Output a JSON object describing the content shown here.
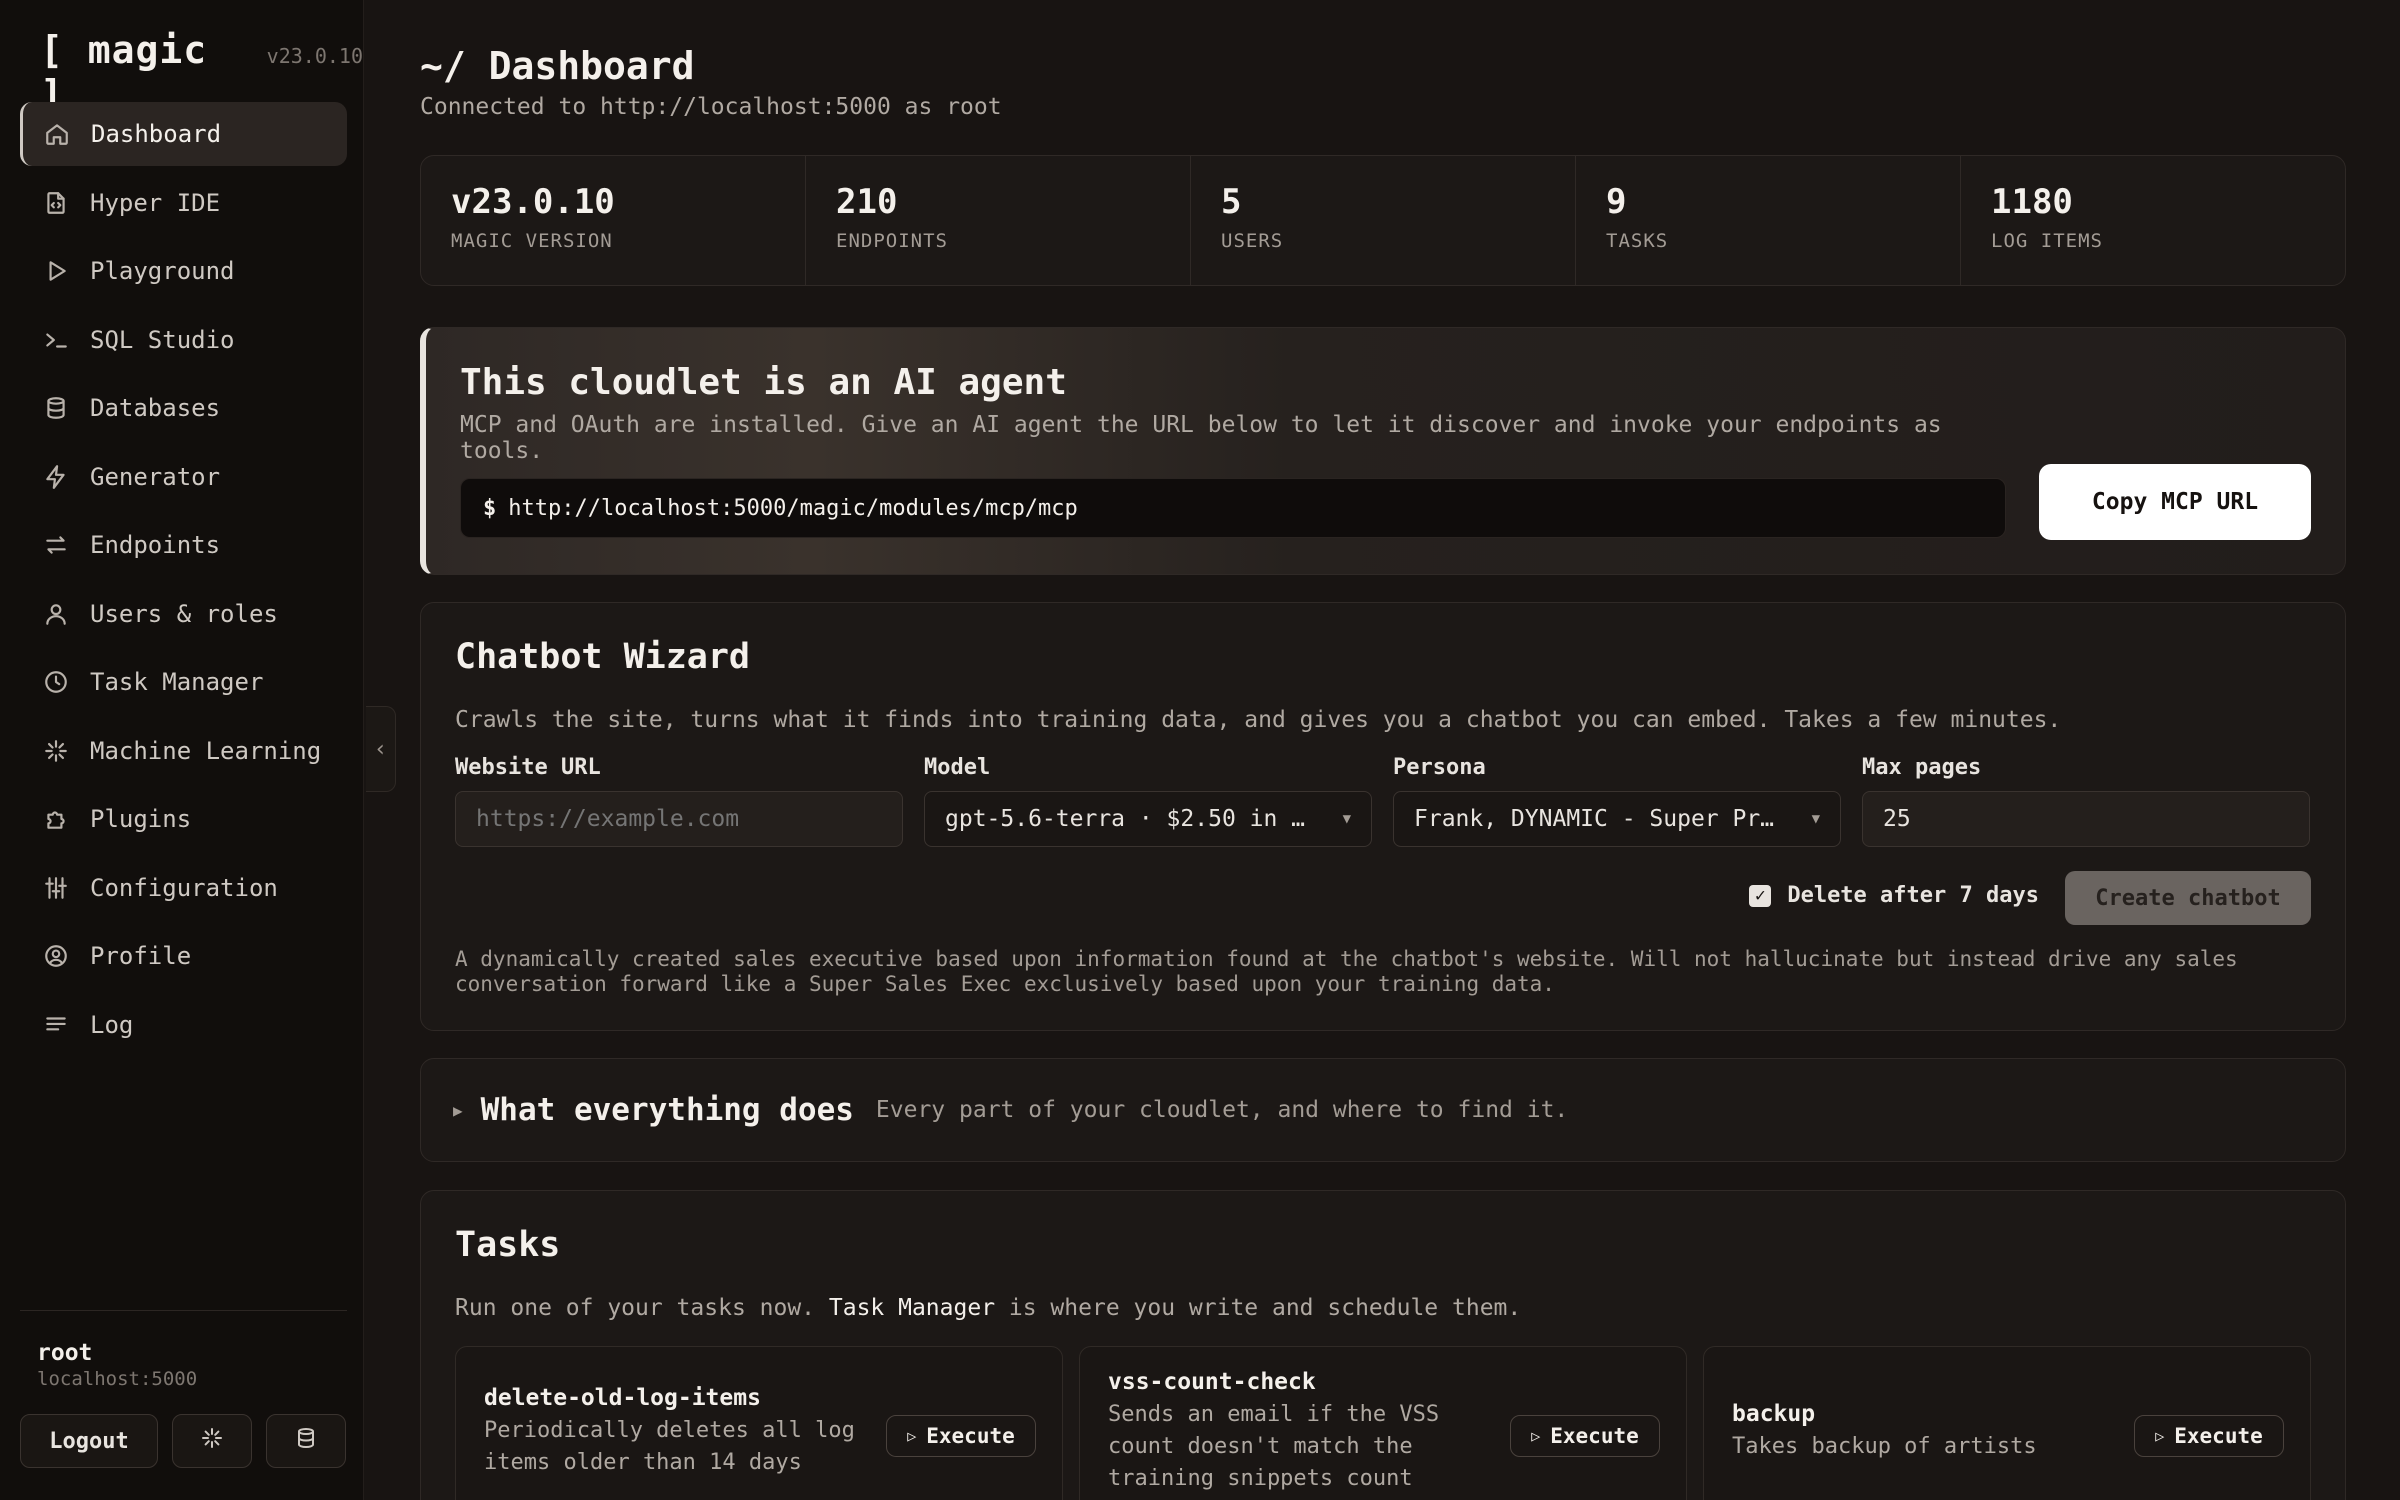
{
  "brand": {
    "name": "[ magic ]",
    "version": "v23.0.10"
  },
  "nav": [
    {
      "label": "Dashboard",
      "icon": "home-icon"
    },
    {
      "label": "Hyper IDE",
      "icon": "code-file-icon"
    },
    {
      "label": "Playground",
      "icon": "play-icon"
    },
    {
      "label": "SQL Studio",
      "icon": "terminal-icon"
    },
    {
      "label": "Databases",
      "icon": "database-icon"
    },
    {
      "label": "Generator",
      "icon": "lightning-icon"
    },
    {
      "label": "Endpoints",
      "icon": "arrows-icon"
    },
    {
      "label": "Users & roles",
      "icon": "user-icon"
    },
    {
      "label": "Task Manager",
      "icon": "clock-icon"
    },
    {
      "label": "Machine Learning",
      "icon": "sparkle-icon"
    },
    {
      "label": "Plugins",
      "icon": "puzzle-icon"
    },
    {
      "label": "Configuration",
      "icon": "sliders-icon"
    },
    {
      "label": "Profile",
      "icon": "profile-icon"
    },
    {
      "label": "Log",
      "icon": "list-icon"
    }
  ],
  "user": {
    "name": "root",
    "host": "localhost:5000",
    "logout_label": "Logout"
  },
  "header": {
    "title": "~/ Dashboard",
    "subtitle": "Connected to http://localhost:5000 as root"
  },
  "stats": [
    {
      "value": "v23.0.10",
      "label": "MAGIC VERSION"
    },
    {
      "value": "210",
      "label": "ENDPOINTS"
    },
    {
      "value": "5",
      "label": "USERS"
    },
    {
      "value": "9",
      "label": "TASKS"
    },
    {
      "value": "1180",
      "label": "LOG ITEMS"
    }
  ],
  "agent": {
    "title": "This cloudlet is an AI agent",
    "description": "MCP and OAuth are installed. Give an AI agent the URL below to let it discover and invoke your endpoints as tools.",
    "prompt": "$",
    "url": "http://localhost:5000/magic/modules/mcp/mcp",
    "copy_label": "Copy MCP URL"
  },
  "wizard": {
    "title": "Chatbot Wizard",
    "description": "Crawls the site, turns what it finds into training data, and gives you a chatbot you can embed. Takes a few minutes.",
    "website_label": "Website URL",
    "website_placeholder": "https://example.com",
    "model_label": "Model",
    "model_value": "gpt-5.6-terra · $2.50 in …",
    "persona_label": "Persona",
    "persona_value": "Frank, DYNAMIC - Super Pr…",
    "max_pages_label": "Max pages",
    "max_pages_value": "25",
    "delete_label": "Delete after 7 days",
    "delete_checked": true,
    "create_label": "Create chatbot",
    "persona_description": "A dynamically created sales executive based upon information found at the chatbot's website. Will not hallucinate but instead drive any sales conversation forward like a Super Sales Exec exclusively based upon your training data."
  },
  "everything": {
    "title": "What everything does",
    "subtitle": "Every part of your cloudlet, and where to find it."
  },
  "tasks": {
    "title": "Tasks",
    "desc_before": "Run one of your tasks now. ",
    "desc_link": "Task Manager",
    "desc_after": " is where you write and schedule them.",
    "execute_label": "Execute",
    "items": [
      {
        "name": "delete-old-log-items",
        "description": "Periodically deletes all log items older than 14 days"
      },
      {
        "name": "vss-count-check",
        "description": "Sends an email if the VSS count doesn't match the training snippets count"
      },
      {
        "name": "backup",
        "description": "Takes backup of artists"
      }
    ]
  }
}
